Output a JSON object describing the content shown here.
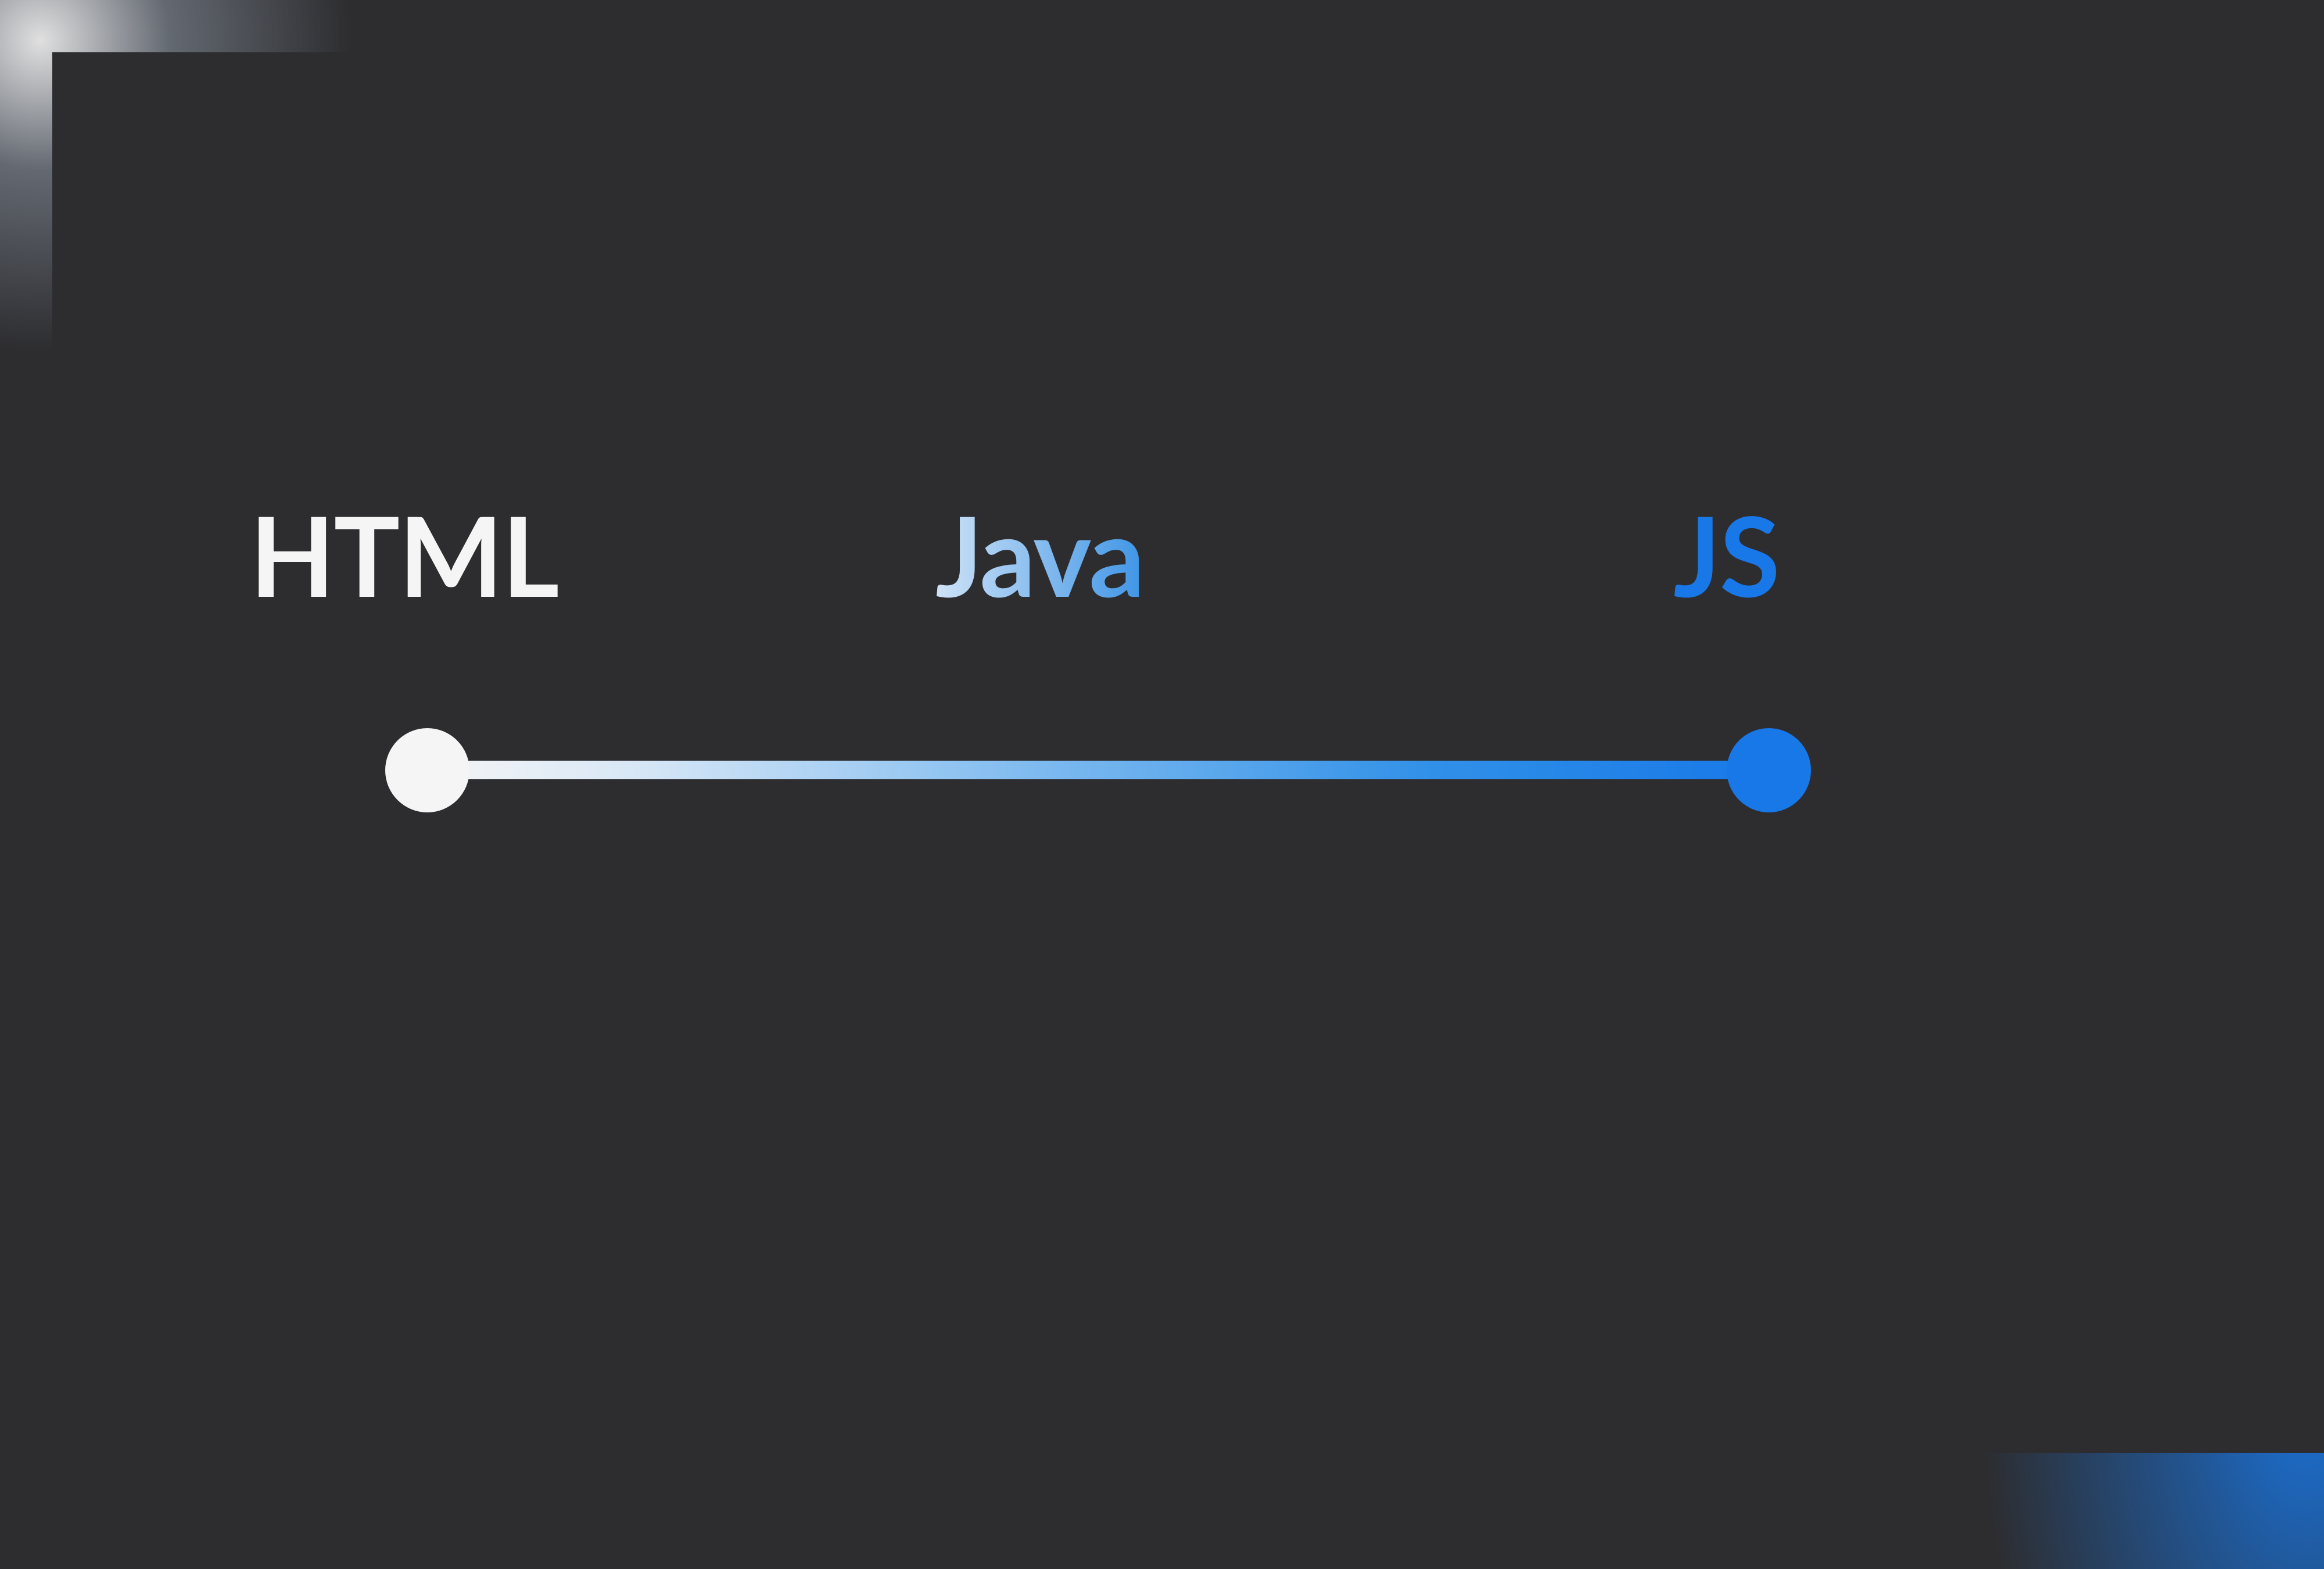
{
  "diagram": {
    "labels": {
      "start": "HTML",
      "middle": "Java",
      "end": "JS"
    },
    "colors": {
      "background": "#2d2d30",
      "start": "#f5f5f5",
      "end": "#1878e8",
      "gradient_start": "#f5f5f5",
      "gradient_end": "#1878e8"
    }
  }
}
